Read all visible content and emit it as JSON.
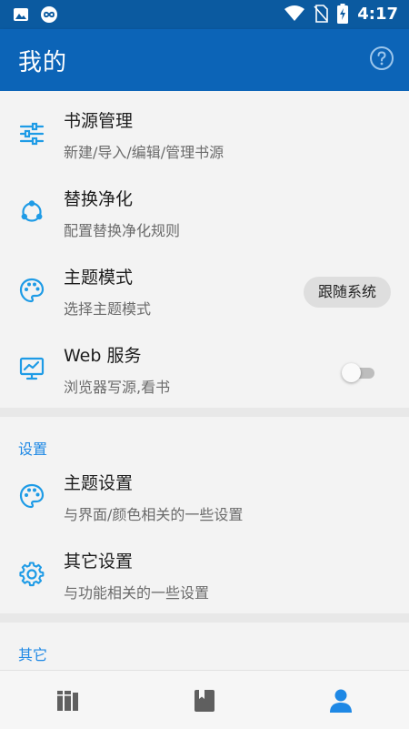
{
  "status_bar": {
    "time": "4:17",
    "icons": [
      "image-icon",
      "infinity-icon",
      "wifi-icon",
      "sim-off-icon",
      "battery-charging-icon"
    ]
  },
  "app_bar": {
    "title": "我的",
    "help_icon": "help-circle-icon"
  },
  "main": {
    "items": [
      {
        "icon": "sliders-icon",
        "title": "书源管理",
        "subtitle": "新建/导入/编辑/管理书源"
      },
      {
        "icon": "replace-icon",
        "title": "替换净化",
        "subtitle": "配置替换净化规则"
      },
      {
        "icon": "palette-icon",
        "title": "主题模式",
        "subtitle": "选择主题模式",
        "chip": "跟随系统"
      },
      {
        "icon": "monitor-chart-icon",
        "title": "Web 服务",
        "subtitle": "浏览器写源,看书",
        "toggle_on": false
      }
    ]
  },
  "settings": {
    "header": "设置",
    "items": [
      {
        "icon": "palette-icon",
        "title": "主题设置",
        "subtitle": "与界面/颜色相关的一些设置"
      },
      {
        "icon": "gear-icon",
        "title": "其它设置",
        "subtitle": "与功能相关的一些设置"
      }
    ]
  },
  "other": {
    "header": "其它"
  },
  "bottom_nav": {
    "items": [
      {
        "icon": "bookshelf-icon",
        "active": false
      },
      {
        "icon": "bookmark-book-icon",
        "active": false
      },
      {
        "icon": "person-icon",
        "active": true
      }
    ]
  },
  "colors": {
    "status_bar": "#0b5aa0",
    "app_bar": "#0c64b7",
    "accent": "#1e88e5",
    "icon_blue": "#1e9be6"
  }
}
